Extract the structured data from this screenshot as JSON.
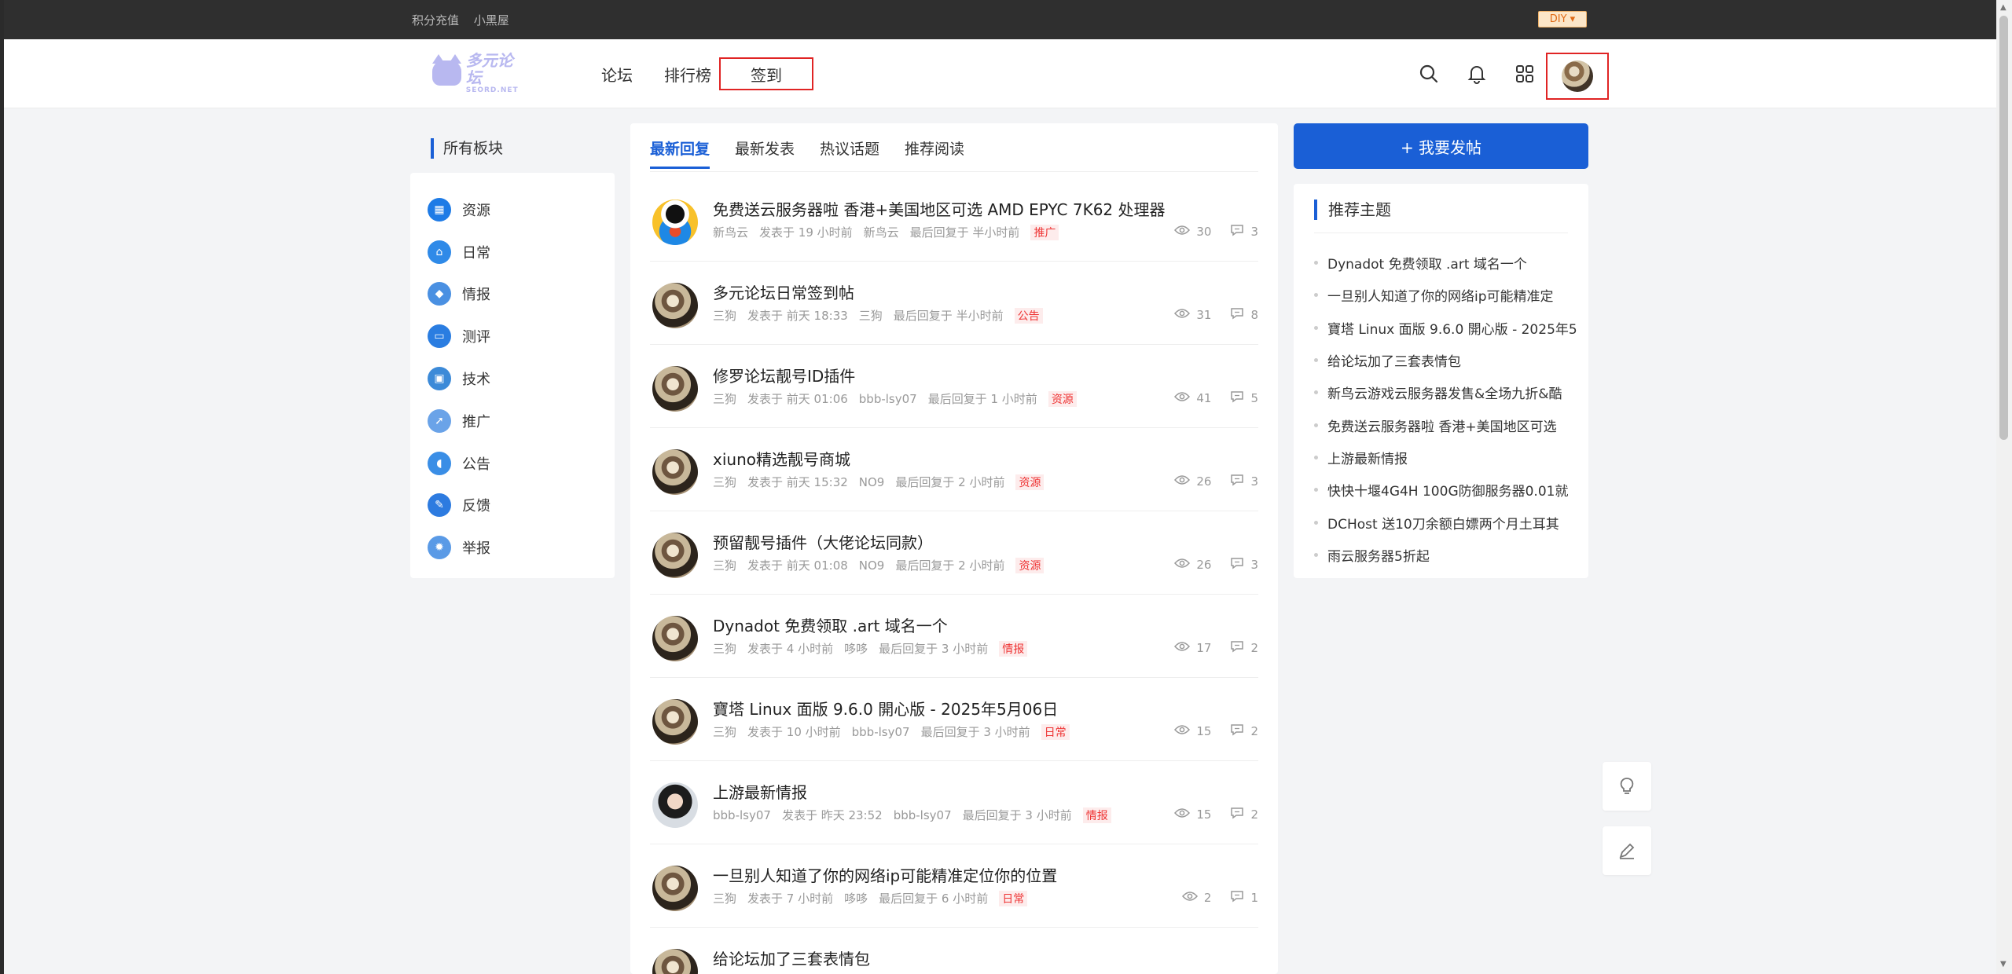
{
  "topbar": {
    "links": [
      "积分充值",
      "小黑屋"
    ],
    "diy_label": "DIY ▾"
  },
  "logo": {
    "text": "多元论坛",
    "sub": "SEORD.NET"
  },
  "nav": {
    "items": [
      "论坛",
      "排行榜",
      "签到"
    ]
  },
  "sidebar": {
    "title": "所有板块",
    "items": [
      {
        "label": "资源",
        "icon": "resource-icon",
        "color": "#1e7be6"
      },
      {
        "label": "日常",
        "icon": "home-icon",
        "color": "#2f8ae8"
      },
      {
        "label": "情报",
        "icon": "intel-icon",
        "color": "#4a90e2"
      },
      {
        "label": "测评",
        "icon": "review-icon",
        "color": "#2a7de1"
      },
      {
        "label": "技术",
        "icon": "tech-icon",
        "color": "#3c8ad8"
      },
      {
        "label": "推广",
        "icon": "promote-icon",
        "color": "#6aa3e8"
      },
      {
        "label": "公告",
        "icon": "announce-icon",
        "color": "#3a8ee6"
      },
      {
        "label": "反馈",
        "icon": "feedback-icon",
        "color": "#2d7be0"
      },
      {
        "label": "举报",
        "icon": "report-icon",
        "color": "#5a9ae6"
      }
    ]
  },
  "tabs": [
    "最新回复",
    "最新发表",
    "热议话题",
    "推荐阅读"
  ],
  "threads": [
    {
      "title": "免费送云服务器啦 香港+美国地区可选 AMD EPYC 7K62 处理器",
      "author": "新鸟云",
      "posted": "发表于 19 小时前",
      "last_user": "新鸟云",
      "last_reply": "最后回复于 半小时前",
      "tag": "推广",
      "views": "30",
      "replies": "3",
      "avatar": "penguin"
    },
    {
      "title": "多元论坛日常签到帖",
      "author": "三狗",
      "posted": "发表于 前天 18:33",
      "last_user": "三狗",
      "last_reply": "最后回复于 半小时前",
      "tag": "公告",
      "views": "31",
      "replies": "8",
      "avatar": "dog"
    },
    {
      "title": "修罗论坛靓号ID插件",
      "author": "三狗",
      "posted": "发表于 前天 01:06",
      "last_user": "bbb-lsy07",
      "last_reply": "最后回复于 1 小时前",
      "tag": "资源",
      "views": "41",
      "replies": "5",
      "avatar": "dog"
    },
    {
      "title": "xiuno精选靓号商城",
      "author": "三狗",
      "posted": "发表于 前天 15:32",
      "last_user": "NO9",
      "last_reply": "最后回复于 2 小时前",
      "tag": "资源",
      "views": "26",
      "replies": "3",
      "avatar": "dog"
    },
    {
      "title": "预留靓号插件（大佬论坛同款）",
      "author": "三狗",
      "posted": "发表于 前天 01:08",
      "last_user": "NO9",
      "last_reply": "最后回复于 2 小时前",
      "tag": "资源",
      "views": "26",
      "replies": "3",
      "avatar": "dog"
    },
    {
      "title": "Dynadot 免费领取 .art 域名一个",
      "author": "三狗",
      "posted": "发表于 4 小时前",
      "last_user": "哆哆",
      "last_reply": "最后回复于 3 小时前",
      "tag": "情报",
      "views": "17",
      "replies": "2",
      "avatar": "dog"
    },
    {
      "title": "寶塔 Linux 面版 9.6.0 開心版 - 2025年5月06日",
      "author": "三狗",
      "posted": "发表于 10 小时前",
      "last_user": "bbb-lsy07",
      "last_reply": "最后回复于 3 小时前",
      "tag": "日常",
      "views": "15",
      "replies": "2",
      "avatar": "dog"
    },
    {
      "title": "上游最新情报",
      "author": "bbb-lsy07",
      "posted": "发表于 昨天 23:52",
      "last_user": "bbb-lsy07",
      "last_reply": "最后回复于 3 小时前",
      "tag": "情报",
      "views": "15",
      "replies": "2",
      "avatar": "person"
    },
    {
      "title": "一旦别人知道了你的网络ip可能精准定位你的位置",
      "author": "三狗",
      "posted": "发表于 7 小时前",
      "last_user": "哆哆",
      "last_reply": "最后回复于 6 小时前",
      "tag": "日常",
      "views": "2",
      "replies": "1",
      "avatar": "dog"
    },
    {
      "title": "给论坛加了三套表情包",
      "author": "",
      "posted": "",
      "last_user": "",
      "last_reply": "",
      "tag": "",
      "views": "",
      "replies": "",
      "avatar": "dog"
    }
  ],
  "post_button": "+ 我要发帖",
  "recommend": {
    "title": "推荐主题",
    "items": [
      "Dynadot 免费领取 .art 域名一个",
      "一旦别人知道了你的网络ip可能精准定",
      "寶塔 Linux 面版 9.6.0 開心版 - 2025年5",
      "给论坛加了三套表情包",
      "新鸟云游戏云服务器发售&全场九折&酷",
      "免费送云服务器啦 香港+美国地区可选",
      "上游最新情报",
      "快快十堰4G4H 100G防御服务器0.01就",
      "DCHost 送10刀余额白嫖两个月土耳其",
      "雨云服务器5折起"
    ]
  },
  "colors": {
    "accent": "#1a5fd6",
    "highlight_border": "#e02424",
    "tag": "#e33"
  }
}
